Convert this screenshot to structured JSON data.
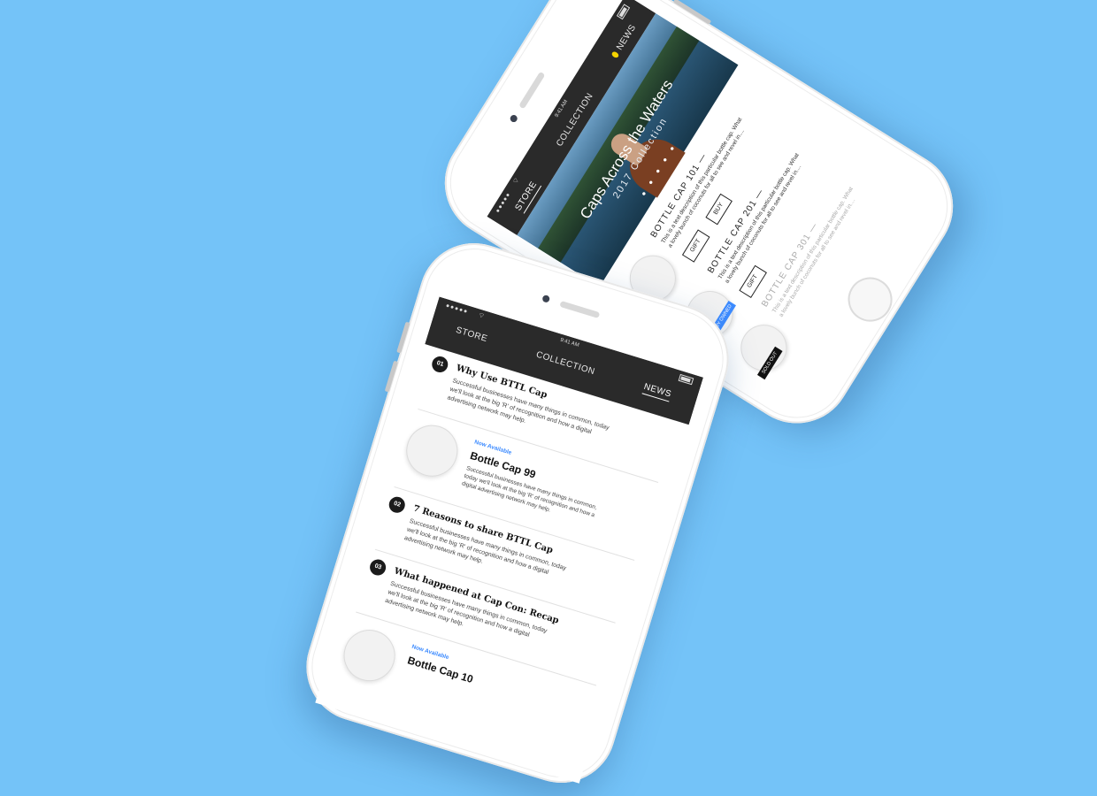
{
  "phone1": {
    "status": {
      "signal": "●●●●●",
      "time": "9:41 AM"
    },
    "nav": {
      "store": "STORE",
      "collection": "COLLECTION",
      "news": "NEWS"
    },
    "hero": {
      "title": "Caps Across the Waters",
      "subtitle": "2017 Collection",
      "dots": "● ● ● ● ●"
    },
    "products": [
      {
        "title": "BOTTLE CAP 101 —",
        "desc": "This is a text description of this particular bottle cap. What a lovely bunch of coconuts for all to see and revel in....",
        "buttons": [
          "GIFT",
          "BUY"
        ]
      },
      {
        "title": "BOTTLE CAP 201 —",
        "desc": "This is a text description of this particular bottle cap. What a lovely bunch of coconuts for all to see and revel in....",
        "badge": "ALREADY OWNED",
        "buttons": [
          "GIFT"
        ]
      },
      {
        "title": "BOTTLE CAP 301 —",
        "desc": "This is a text description of this particular bottle cap. What a lovely bunch of coconuts for all to see and revel in....",
        "badge": "SOLD OUT"
      }
    ]
  },
  "phone2": {
    "status": {
      "signal": "●●●●●",
      "time": "9:41 AM"
    },
    "nav": {
      "store": "STORE",
      "collection": "COLLECTION",
      "news": "NEWS"
    },
    "articles": [
      {
        "num": "01",
        "title": "Why Use BTTL Cap",
        "desc": "Successful businesses have many things in common, today we'll look at the big 'R' of recognition and how a digital advertising network may help."
      },
      {
        "num": "02",
        "title": "7 Reasons to share BTTL Cap",
        "desc": "Successful businesses have many things in common, today we'll look at the big 'R' of recognition and how a digital advertising network may help."
      },
      {
        "num": "03",
        "title": "What happened at Cap Con: Recap",
        "desc": "Successful businesses have many things in common, today we'll look at the big 'R' of recognition and how a digital advertising network may help."
      }
    ],
    "promos": [
      {
        "label": "Now Available",
        "title": "Bottle Cap 99",
        "desc": "Successful businesses have many things in common, today we'll look at the big 'R' of recognition and how a digital advertising network may help."
      },
      {
        "label": "Now Available",
        "title": "Bottle Cap 10"
      }
    ]
  },
  "colors": {
    "background": "#74c3f8",
    "accent": "#3d8bff",
    "bar": "#2a2a2a",
    "dot": "#f5d400"
  }
}
